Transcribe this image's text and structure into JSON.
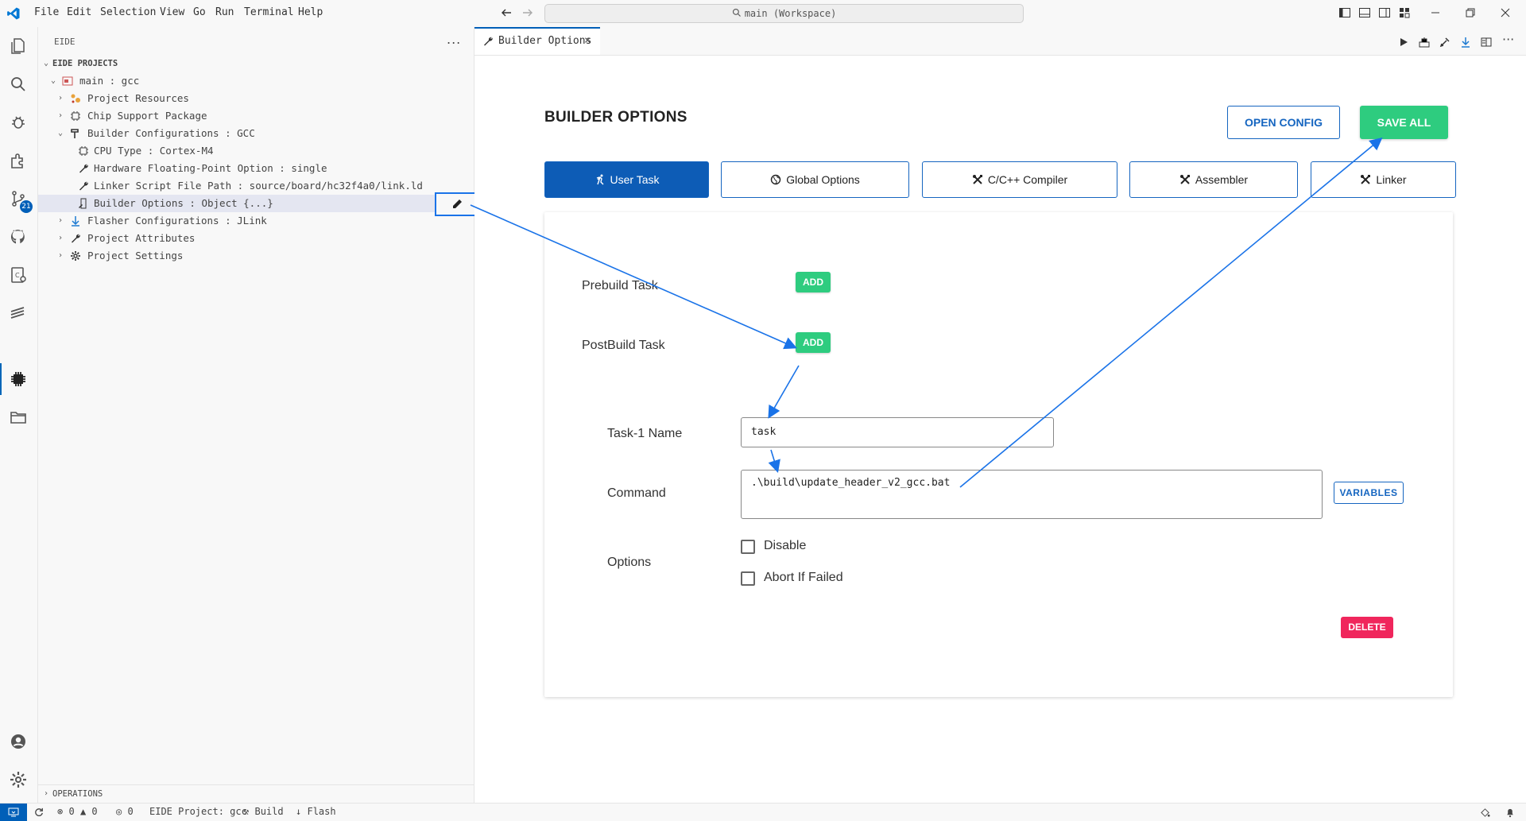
{
  "menu": [
    "File",
    "Edit",
    "Selection",
    "View",
    "Go",
    "Run",
    "Terminal",
    "Help"
  ],
  "command_center": "main (Workspace)",
  "activity_badge": "21",
  "sidebar": {
    "title": "EIDE",
    "more": "...",
    "section": "EIDE PROJECTS",
    "tree": [
      {
        "label": "main : gcc"
      },
      {
        "label": "Project Resources"
      },
      {
        "label": "Chip Support Package"
      },
      {
        "label": "Builder Configurations : GCC"
      },
      {
        "label": "CPU Type : Cortex-M4"
      },
      {
        "label": "Hardware Floating-Point Option : single"
      },
      {
        "label": "Linker Script File Path : source/board/hc32f4a0/link.ld"
      },
      {
        "label": "Builder Options : Object {...}"
      },
      {
        "label": "Flasher Configurations : JLink"
      },
      {
        "label": "Project Attributes"
      },
      {
        "label": "Project Settings"
      }
    ],
    "operations": "OPERATIONS"
  },
  "editor": {
    "tab_label": "Builder Options",
    "title": "BUILDER OPTIONS",
    "open_config": "OPEN CONFIG",
    "save_all": "SAVE ALL",
    "tabs": [
      "User Task",
      "Global Options",
      "C/C++ Compiler",
      "Assembler",
      "Linker"
    ],
    "prebuild_label": "Prebuild Task",
    "postbuild_label": "PostBuild Task",
    "add_label": "ADD",
    "task_name_label": "Task-1 Name",
    "task_name_value": "task",
    "command_label": "Command",
    "command_value": ".\\build\\update_header_v2_gcc.bat",
    "variables": "VARIABLES",
    "options_label": "Options",
    "disable_label": "Disable",
    "abort_label": "Abort If Failed",
    "delete": "DELETE"
  },
  "statusbar": {
    "errors": "0",
    "warnings": "0",
    "ports": "0",
    "project": "EIDE Project: gcc",
    "build": "Build",
    "flash": "Flash"
  },
  "colors": {
    "accent": "#005fb8",
    "primary": "#0d5cb6",
    "success": "#2ecc7f",
    "danger": "#f0265c",
    "annotation": "#1a73e8"
  }
}
